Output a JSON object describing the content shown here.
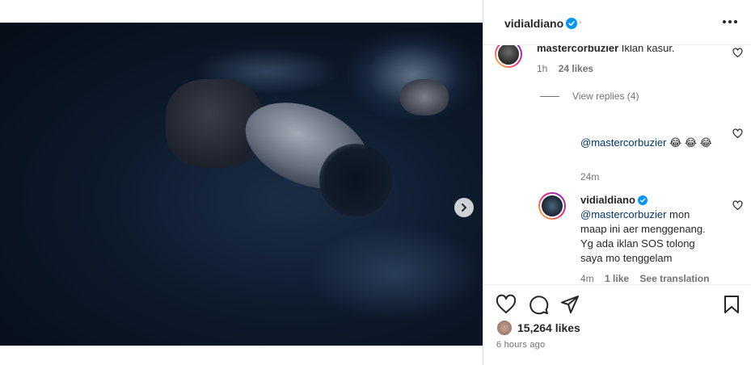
{
  "post": {
    "author": "vidialdiano",
    "carousel": {
      "current": 1,
      "total": 2
    }
  },
  "comments": [
    {
      "username": "mastercorbuzier",
      "text": "Iklan kasur.",
      "time": "1h",
      "likes": "24 likes",
      "view_replies": "View replies (4)"
    },
    {
      "mention": "@mastercorbuzier",
      "text": " 😂 😂 😂",
      "time": "24m"
    },
    {
      "username": "vidialdiano",
      "mention": "@mastercorbuzier",
      "text": " mon maap ini aer menggenang. Yg ada iklan SOS tolong saya mo tenggelam",
      "time": "4m",
      "likes": "1 like",
      "see_translation": "See translation"
    }
  ],
  "footer": {
    "likes": "15,264 likes",
    "time_ago": "6 hours ago"
  },
  "colors": {
    "verified": "#0095f6",
    "mention": "#00376b",
    "muted": "#737373"
  },
  "icons": [
    "verified-badge-icon",
    "more-options-icon",
    "heart-icon",
    "comment-icon",
    "share-icon",
    "bookmark-icon",
    "chevron-right-icon"
  ]
}
